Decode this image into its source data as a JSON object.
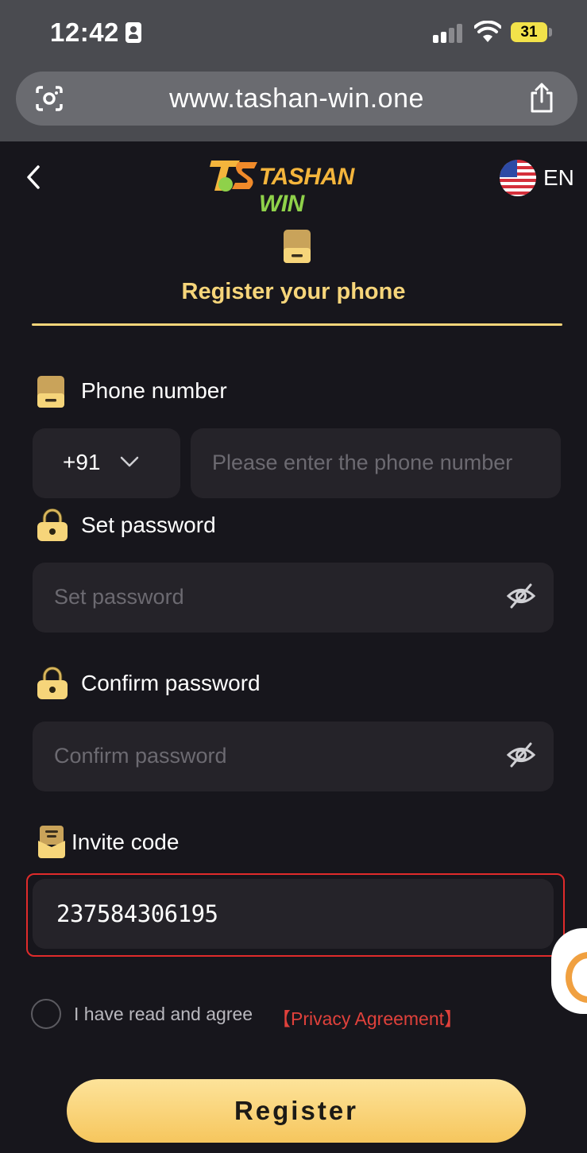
{
  "status_bar": {
    "time": "12:42",
    "battery": "31"
  },
  "browser": {
    "url": "www.tashan-win.one"
  },
  "header": {
    "logo_part1": "TASHAN",
    "logo_part2": "WIN",
    "language": "EN"
  },
  "hero": {
    "title": "Register your phone"
  },
  "form": {
    "phone_label": "Phone number",
    "country_code": "+91",
    "phone_placeholder": "Please enter the phone number",
    "password_label": "Set password",
    "password_placeholder": "Set password",
    "confirm_label": "Confirm password",
    "confirm_placeholder": "Confirm password",
    "invite_label": "Invite code",
    "invite_value": "237584306195",
    "agree_text": "I have read and agree",
    "privacy_link": "【Privacy Agreement】",
    "register_label": "Register"
  },
  "colors": {
    "accent": "#f6d57a",
    "background": "#17161c",
    "field": "#252329",
    "link": "#e0413b",
    "highlight": "#e02b2b"
  }
}
